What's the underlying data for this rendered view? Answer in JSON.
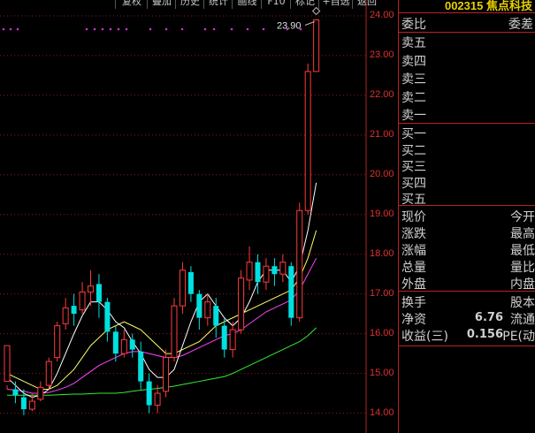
{
  "toolbar": {
    "buttons": [
      "复权",
      "叠加",
      "历史",
      "统计",
      "画线",
      "F10",
      "标记",
      "+自选",
      "返回"
    ]
  },
  "stock": {
    "code": "002315",
    "name": "焦点科技"
  },
  "panel": {
    "order_book": {
      "header_left": "委比",
      "header_right": "委差",
      "sell": [
        "卖五",
        "卖四",
        "卖三",
        "卖二",
        "卖一"
      ],
      "buy": [
        "买一",
        "买二",
        "买三",
        "买四",
        "买五"
      ]
    },
    "quote": [
      {
        "left": "现价",
        "right": "今开"
      },
      {
        "left": "涨跌",
        "right": "最高"
      },
      {
        "left": "涨幅",
        "right": "最低"
      },
      {
        "left": "总量",
        "right": "量比"
      },
      {
        "left": "外盘",
        "right": "内盘"
      }
    ],
    "fundamentals": [
      {
        "left": "换手",
        "value": "",
        "right": "股本"
      },
      {
        "left": "净资",
        "value": "6.76",
        "right": "流通"
      },
      {
        "left": "收益(三)",
        "value": "0.156",
        "right": "PE(动"
      }
    ]
  },
  "chart_data": {
    "type": "candlestick",
    "y_ticks": [
      24.0,
      23.0,
      22.0,
      21.0,
      20.0,
      19.0,
      18.0,
      17.0,
      16.0,
      15.0,
      14.0
    ],
    "y_tick_labels": [
      "24.00",
      "23.00",
      "22.00",
      "21.00",
      "20.00",
      "19.00",
      "18.00",
      "17.00",
      "16.00",
      "15.00",
      "14.00"
    ],
    "ylim": [
      13.5,
      24.4
    ],
    "high_annotation": {
      "label": "23.90",
      "value": 23.9
    },
    "colors": {
      "up": "#ff3b3b",
      "down": "#00e0e0",
      "ma5": "#ffffff",
      "ma10": "#ffff66",
      "ma20": "#ff44ff",
      "ma60": "#33ee33",
      "axis": "#b22222"
    },
    "candles": [
      [
        14.8,
        15.7,
        14.7,
        14.6
      ],
      [
        14.6,
        14.45,
        14.8,
        14.25
      ],
      [
        14.4,
        14.1,
        14.6,
        13.95
      ],
      [
        14.1,
        14.3,
        14.5,
        14.05
      ],
      [
        14.35,
        14.65,
        14.8,
        14.3
      ],
      [
        14.7,
        15.3,
        15.4,
        14.6
      ],
      [
        15.4,
        16.2,
        16.3,
        15.3
      ],
      [
        16.25,
        16.65,
        16.9,
        16.1
      ],
      [
        16.7,
        16.5,
        17.0,
        16.2
      ],
      [
        16.6,
        17.05,
        17.3,
        16.5
      ],
      [
        17.05,
        17.2,
        17.6,
        16.7
      ],
      [
        17.25,
        16.8,
        17.5,
        16.4
      ],
      [
        16.8,
        16.05,
        16.9,
        15.8
      ],
      [
        16.05,
        15.5,
        16.2,
        15.3
      ],
      [
        15.5,
        15.85,
        16.1,
        15.4
      ],
      [
        15.85,
        15.6,
        16.0,
        15.4
      ],
      [
        15.55,
        14.8,
        15.8,
        14.6
      ],
      [
        14.8,
        14.2,
        15.0,
        14.0
      ],
      [
        14.2,
        14.5,
        14.7,
        14.0
      ],
      [
        14.55,
        15.4,
        15.6,
        14.4
      ],
      [
        15.4,
        16.7,
        16.9,
        15.3
      ],
      [
        16.7,
        17.6,
        17.8,
        16.5
      ],
      [
        17.55,
        17.0,
        17.7,
        16.8
      ],
      [
        17.0,
        16.4,
        17.1,
        16.1
      ],
      [
        16.4,
        16.8,
        17.0,
        16.2
      ],
      [
        16.7,
        16.2,
        16.9,
        15.9
      ],
      [
        16.2,
        15.6,
        16.4,
        15.4
      ],
      [
        15.6,
        16.1,
        16.3,
        15.4
      ],
      [
        16.1,
        17.4,
        17.6,
        16.0
      ],
      [
        17.35,
        17.8,
        18.2,
        17.1
      ],
      [
        17.8,
        17.3,
        18.0,
        17.0
      ],
      [
        17.3,
        17.7,
        17.9,
        17.1
      ],
      [
        17.7,
        17.5,
        17.9,
        17.2
      ],
      [
        17.5,
        17.8,
        18.0,
        17.3
      ],
      [
        17.7,
        16.4,
        17.8,
        16.2
      ],
      [
        16.4,
        19.1,
        19.3,
        16.3
      ],
      [
        19.1,
        22.6,
        22.8,
        19.0
      ],
      [
        22.6,
        23.9,
        23.9,
        22.6
      ]
    ],
    "ma5": [
      14.9,
      14.7,
      14.5,
      14.4,
      14.45,
      14.6,
      15.0,
      15.5,
      16.0,
      16.45,
      16.8,
      16.8,
      16.6,
      16.3,
      16.15,
      15.8,
      15.5,
      15.1,
      14.9,
      14.9,
      15.1,
      15.7,
      16.3,
      16.8,
      17.0,
      16.7,
      16.4,
      16.2,
      16.4,
      16.8,
      17.3,
      17.6,
      17.6,
      17.6,
      17.3,
      17.7,
      18.6,
      19.8
    ],
    "ma10": [
      15.0,
      14.9,
      14.8,
      14.7,
      14.6,
      14.6,
      14.7,
      14.9,
      15.1,
      15.4,
      15.7,
      15.9,
      16.1,
      16.2,
      16.3,
      16.2,
      16.1,
      15.9,
      15.7,
      15.5,
      15.5,
      15.6,
      15.7,
      15.8,
      16.0,
      16.2,
      16.3,
      16.4,
      16.5,
      16.6,
      16.7,
      16.8,
      16.9,
      17.0,
      17.1,
      17.4,
      17.9,
      18.6
    ],
    "ma20": [
      14.6,
      14.58,
      14.55,
      14.5,
      14.5,
      14.52,
      14.58,
      14.65,
      14.75,
      14.9,
      15.05,
      15.2,
      15.3,
      15.4,
      15.5,
      15.55,
      15.55,
      15.5,
      15.45,
      15.4,
      15.4,
      15.45,
      15.55,
      15.65,
      15.75,
      15.85,
      15.95,
      16.0,
      16.1,
      16.25,
      16.4,
      16.55,
      16.65,
      16.75,
      16.85,
      17.1,
      17.5,
      17.9
    ],
    "ma60": [
      14.45,
      14.45,
      14.45,
      14.45,
      14.45,
      14.45,
      14.46,
      14.47,
      14.48,
      14.48,
      14.49,
      14.5,
      14.5,
      14.5,
      14.52,
      14.55,
      14.58,
      14.6,
      14.62,
      14.65,
      14.68,
      14.72,
      14.76,
      14.8,
      14.84,
      14.88,
      14.92,
      15.0,
      15.1,
      15.2,
      15.3,
      15.4,
      15.5,
      15.6,
      15.7,
      15.8,
      15.95,
      16.15
    ]
  }
}
